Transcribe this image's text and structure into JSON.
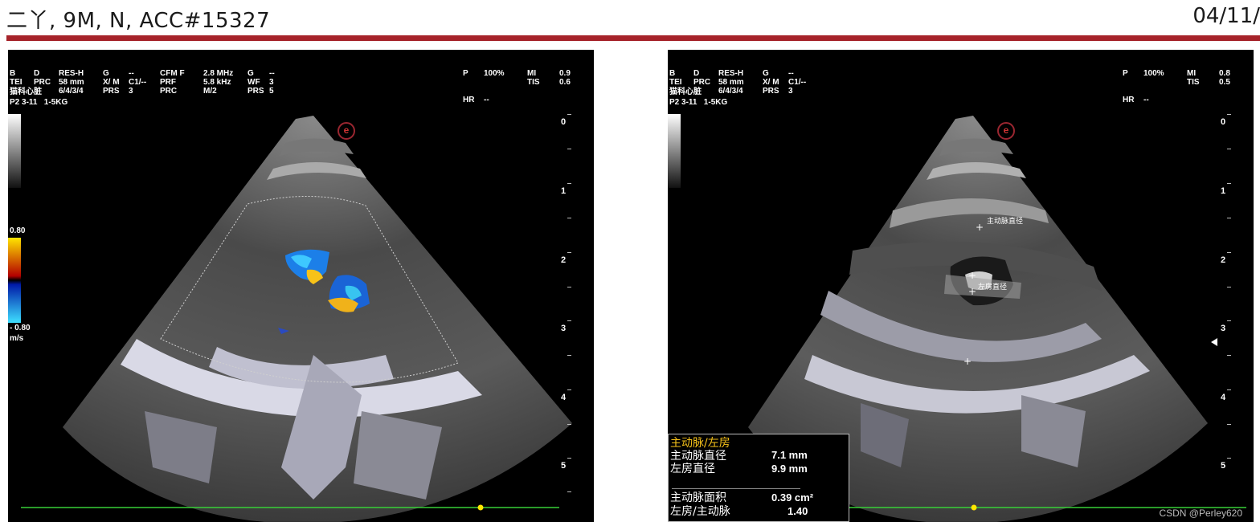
{
  "header": {
    "title": "二丫, 9M, N, ACC#15327",
    "date": "04/11/",
    "bar_color": "#a6232a"
  },
  "left_panel": {
    "params": {
      "c1": [
        "B",
        "TEI"
      ],
      "c2": [
        "RES-H",
        "58 mm",
        "6/4/3/4"
      ],
      "c2pre": [
        "",
        "D",
        "PRC"
      ],
      "c3": [
        "G",
        "X/ M",
        "PRS"
      ],
      "c3v": [
        "--",
        "C1/--",
        "3"
      ],
      "c4": [
        "CFM F",
        "PRF",
        "PRC"
      ],
      "c4v": [
        "2.8 MHz",
        "5.8 kHz",
        "M/2"
      ],
      "c5": [
        "G",
        "WF",
        "PRS"
      ],
      "c5v": [
        "--",
        "3",
        "5"
      ],
      "c6": [
        "P",
        "",
        "HR"
      ],
      "c6v": [
        "100%",
        "",
        "--"
      ],
      "c7": [
        "MI",
        "TIS"
      ],
      "c7v": [
        "0.9",
        "0.6"
      ]
    },
    "preset": "猫科心脏",
    "probe": "P2 3-11   1-5KG",
    "color_scale": {
      "top": "0.80",
      "bottom": "- 0.80",
      "unit": "m/s"
    },
    "depth_ticks": [
      "0",
      "1",
      "2",
      "3",
      "4",
      "5"
    ],
    "logo": "e"
  },
  "right_panel": {
    "params": {
      "c1": [
        "B",
        "TEI"
      ],
      "c2": [
        "RES-H",
        "58 mm",
        "6/4/3/4"
      ],
      "c2pre": [
        "",
        "D",
        "PRC"
      ],
      "c3": [
        "G",
        "X/ M",
        "PRS"
      ],
      "c3v": [
        "--",
        "C1/--",
        "3"
      ],
      "c6": [
        "P",
        "",
        "HR"
      ],
      "c6v": [
        "100%",
        "",
        "--"
      ],
      "c7": [
        "MI",
        "TIS"
      ],
      "c7v": [
        "0.8",
        "0.5"
      ]
    },
    "preset": "猫科心脏",
    "probe": "P2 3-11   1-5KG",
    "depth_ticks": [
      "0",
      "1",
      "2",
      "3",
      "4",
      "5"
    ],
    "logo": "e",
    "annotations": {
      "aorta": "主动脉直径",
      "atrium": "左房直径"
    },
    "measurements": {
      "title": "主动脉/左房",
      "rows": [
        {
          "label": "主动脉直径",
          "value": "7.1 mm"
        },
        {
          "label": "左房直径",
          "value": "9.9 mm"
        },
        {
          "label": "主动脉面积",
          "value": "0.39 cm²"
        },
        {
          "label": "左房/主动脉",
          "value": "1.40"
        }
      ],
      "title_color": "#f6c21a"
    },
    "watermark": "CSDN @Perley620"
  }
}
